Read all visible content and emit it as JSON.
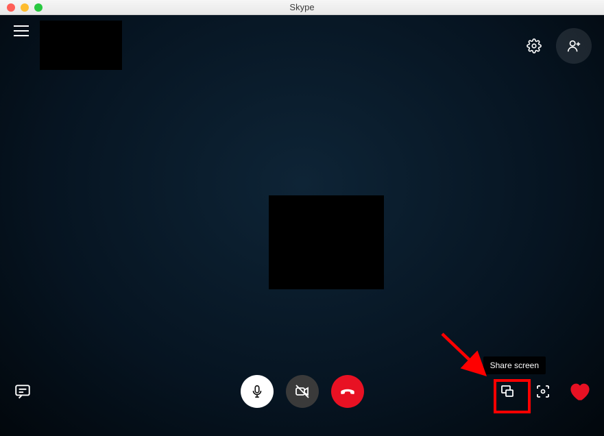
{
  "window": {
    "title": "Skype"
  },
  "tooltip": {
    "share_screen": "Share screen"
  }
}
